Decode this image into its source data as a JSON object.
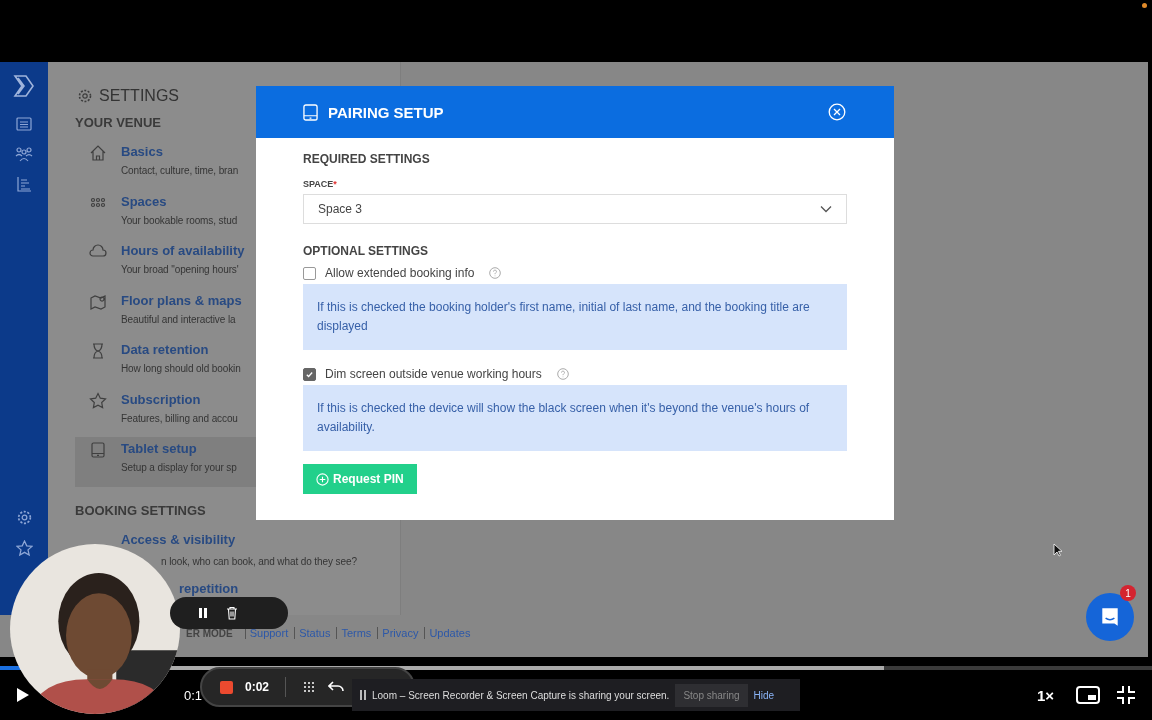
{
  "settings": {
    "title": "SETTINGS",
    "sections": [
      {
        "heading": "YOUR VENUE",
        "items": [
          {
            "title": "Basics",
            "description": "Contact, culture, time, bran",
            "selected": false
          },
          {
            "title": "Spaces",
            "description": "Your bookable rooms, stud",
            "selected": false
          },
          {
            "title": "Hours of availability",
            "description": "Your broad \"opening hours'",
            "selected": false
          },
          {
            "title": "Floor plans & maps",
            "description": "Beautiful and interactive la",
            "selected": false
          },
          {
            "title": "Data retention",
            "description": "How long should old bookin",
            "selected": false
          },
          {
            "title": "Subscription",
            "description": "Features, billing and accou",
            "selected": false
          },
          {
            "title": "Tablet setup",
            "description": "Setup a display for your sp",
            "selected": true
          }
        ]
      },
      {
        "heading": "BOOKING SETTINGS",
        "items": [
          {
            "title": "Access & visibility",
            "description": "n look, who can book, and what do they see?",
            "selected": false
          },
          {
            "title": "repetition",
            "selected": false
          }
        ]
      }
    ]
  },
  "footer": {
    "mode": "ER MODE",
    "links": [
      "Support",
      "Status",
      "Terms",
      "Privacy",
      "Updates"
    ]
  },
  "modal": {
    "title": "PAIRING SETUP",
    "required_heading": "REQUIRED SETTINGS",
    "space_label": "SPACE",
    "required_mark": "*",
    "space_value": "Space 3",
    "optional_heading": "OPTIONAL SETTINGS",
    "options": [
      {
        "label": "Allow extended booking info",
        "checked": false,
        "help": "If this is checked the booking holder's first name, initial of last name, and the booking title are displayed"
      },
      {
        "label": "Dim screen outside venue working hours",
        "checked": true,
        "help": "If this is checked the device will show the black screen when it's beyond the venue's hours of availability."
      }
    ],
    "button": "Request PIN"
  },
  "chat": {
    "badge": "1"
  },
  "player": {
    "progress": {
      "level": 0.02
    },
    "time": "0:1",
    "speed": "1×"
  },
  "recorder": {
    "timer": "0:02"
  },
  "share_banner": {
    "message": "Loom – Screen Recorder & Screen Capture is sharing your screen.",
    "stop": "Stop sharing",
    "hide": "Hide"
  }
}
